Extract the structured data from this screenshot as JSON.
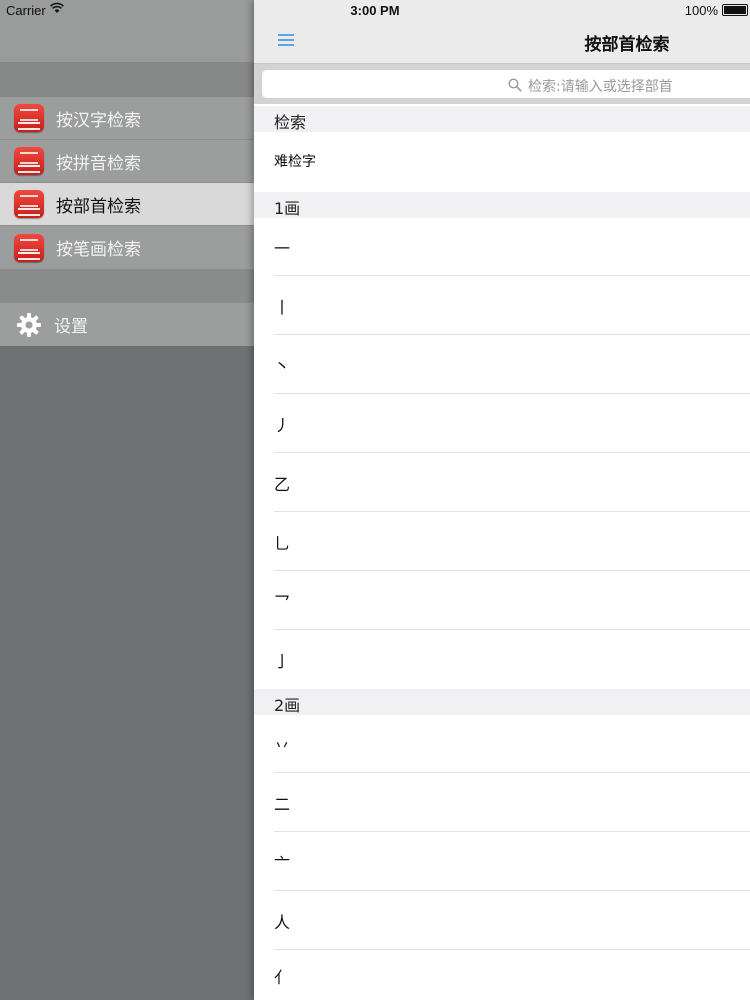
{
  "status_bar": {
    "carrier": "Carrier",
    "time": "3:00 PM",
    "battery": "100%"
  },
  "menu": {
    "items": [
      {
        "label": "按汉字检索",
        "icon": "dictionary-app-icon",
        "active": false
      },
      {
        "label": "按拼音检索",
        "icon": "dictionary-app-icon",
        "active": false
      },
      {
        "label": "按部首检索",
        "icon": "dictionary-app-icon",
        "active": true
      },
      {
        "label": "按笔画检索",
        "icon": "dictionary-app-icon",
        "active": false
      }
    ],
    "settings": {
      "label": "设置",
      "icon": "gear-icon"
    }
  },
  "navbar": {
    "title": "按部首检索",
    "menu_icon": "hamburger-menu-icon"
  },
  "search": {
    "placeholder": "检索:请输入或选择部首",
    "icon": "search-icon"
  },
  "sections": [
    {
      "title": "检索",
      "rows": [
        "难检字"
      ]
    },
    {
      "title": "1画",
      "rows": [
        "一",
        "丨",
        "丶",
        "丿",
        "乙",
        "乚",
        "乛",
        "亅"
      ]
    },
    {
      "title": "2画",
      "rows": [
        "丷",
        "二",
        "亠",
        "人",
        "亻"
      ]
    }
  ],
  "colors": {
    "accent": "#5aa7e6",
    "menu_bg": "#6f7273",
    "active_item": "#d9d9d9"
  }
}
